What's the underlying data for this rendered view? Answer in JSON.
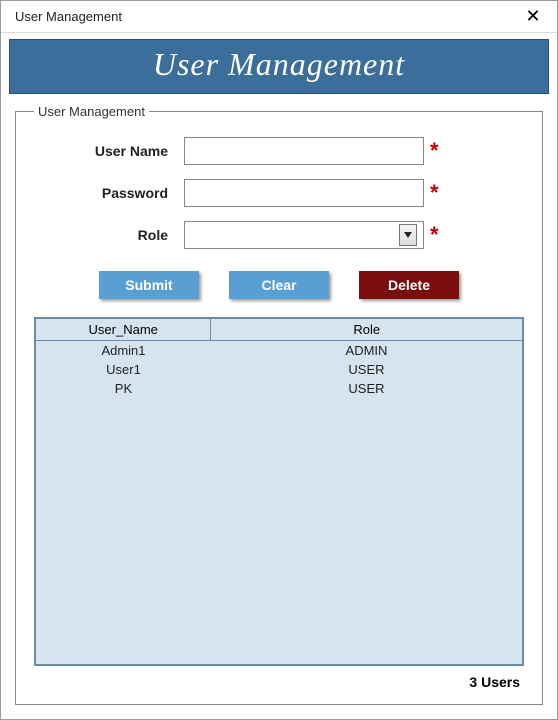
{
  "window": {
    "title": "User Management",
    "close_symbol": "✕"
  },
  "banner": {
    "title": "User Management"
  },
  "group": {
    "legend": "User Management"
  },
  "form": {
    "username_label": "User Name",
    "username_value": "",
    "password_label": "Password",
    "password_value": "",
    "role_label": "Role",
    "role_value": "",
    "required_mark": "*"
  },
  "buttons": {
    "submit": "Submit",
    "clear": "Clear",
    "delete": "Delete"
  },
  "table": {
    "headers": {
      "username": "User_Name",
      "role": "Role"
    },
    "rows": [
      {
        "username": "Admin1",
        "role": "ADMIN"
      },
      {
        "username": "User1",
        "role": "USER"
      },
      {
        "username": "PK",
        "role": "USER"
      }
    ]
  },
  "footer": {
    "count_text": "3 Users"
  }
}
